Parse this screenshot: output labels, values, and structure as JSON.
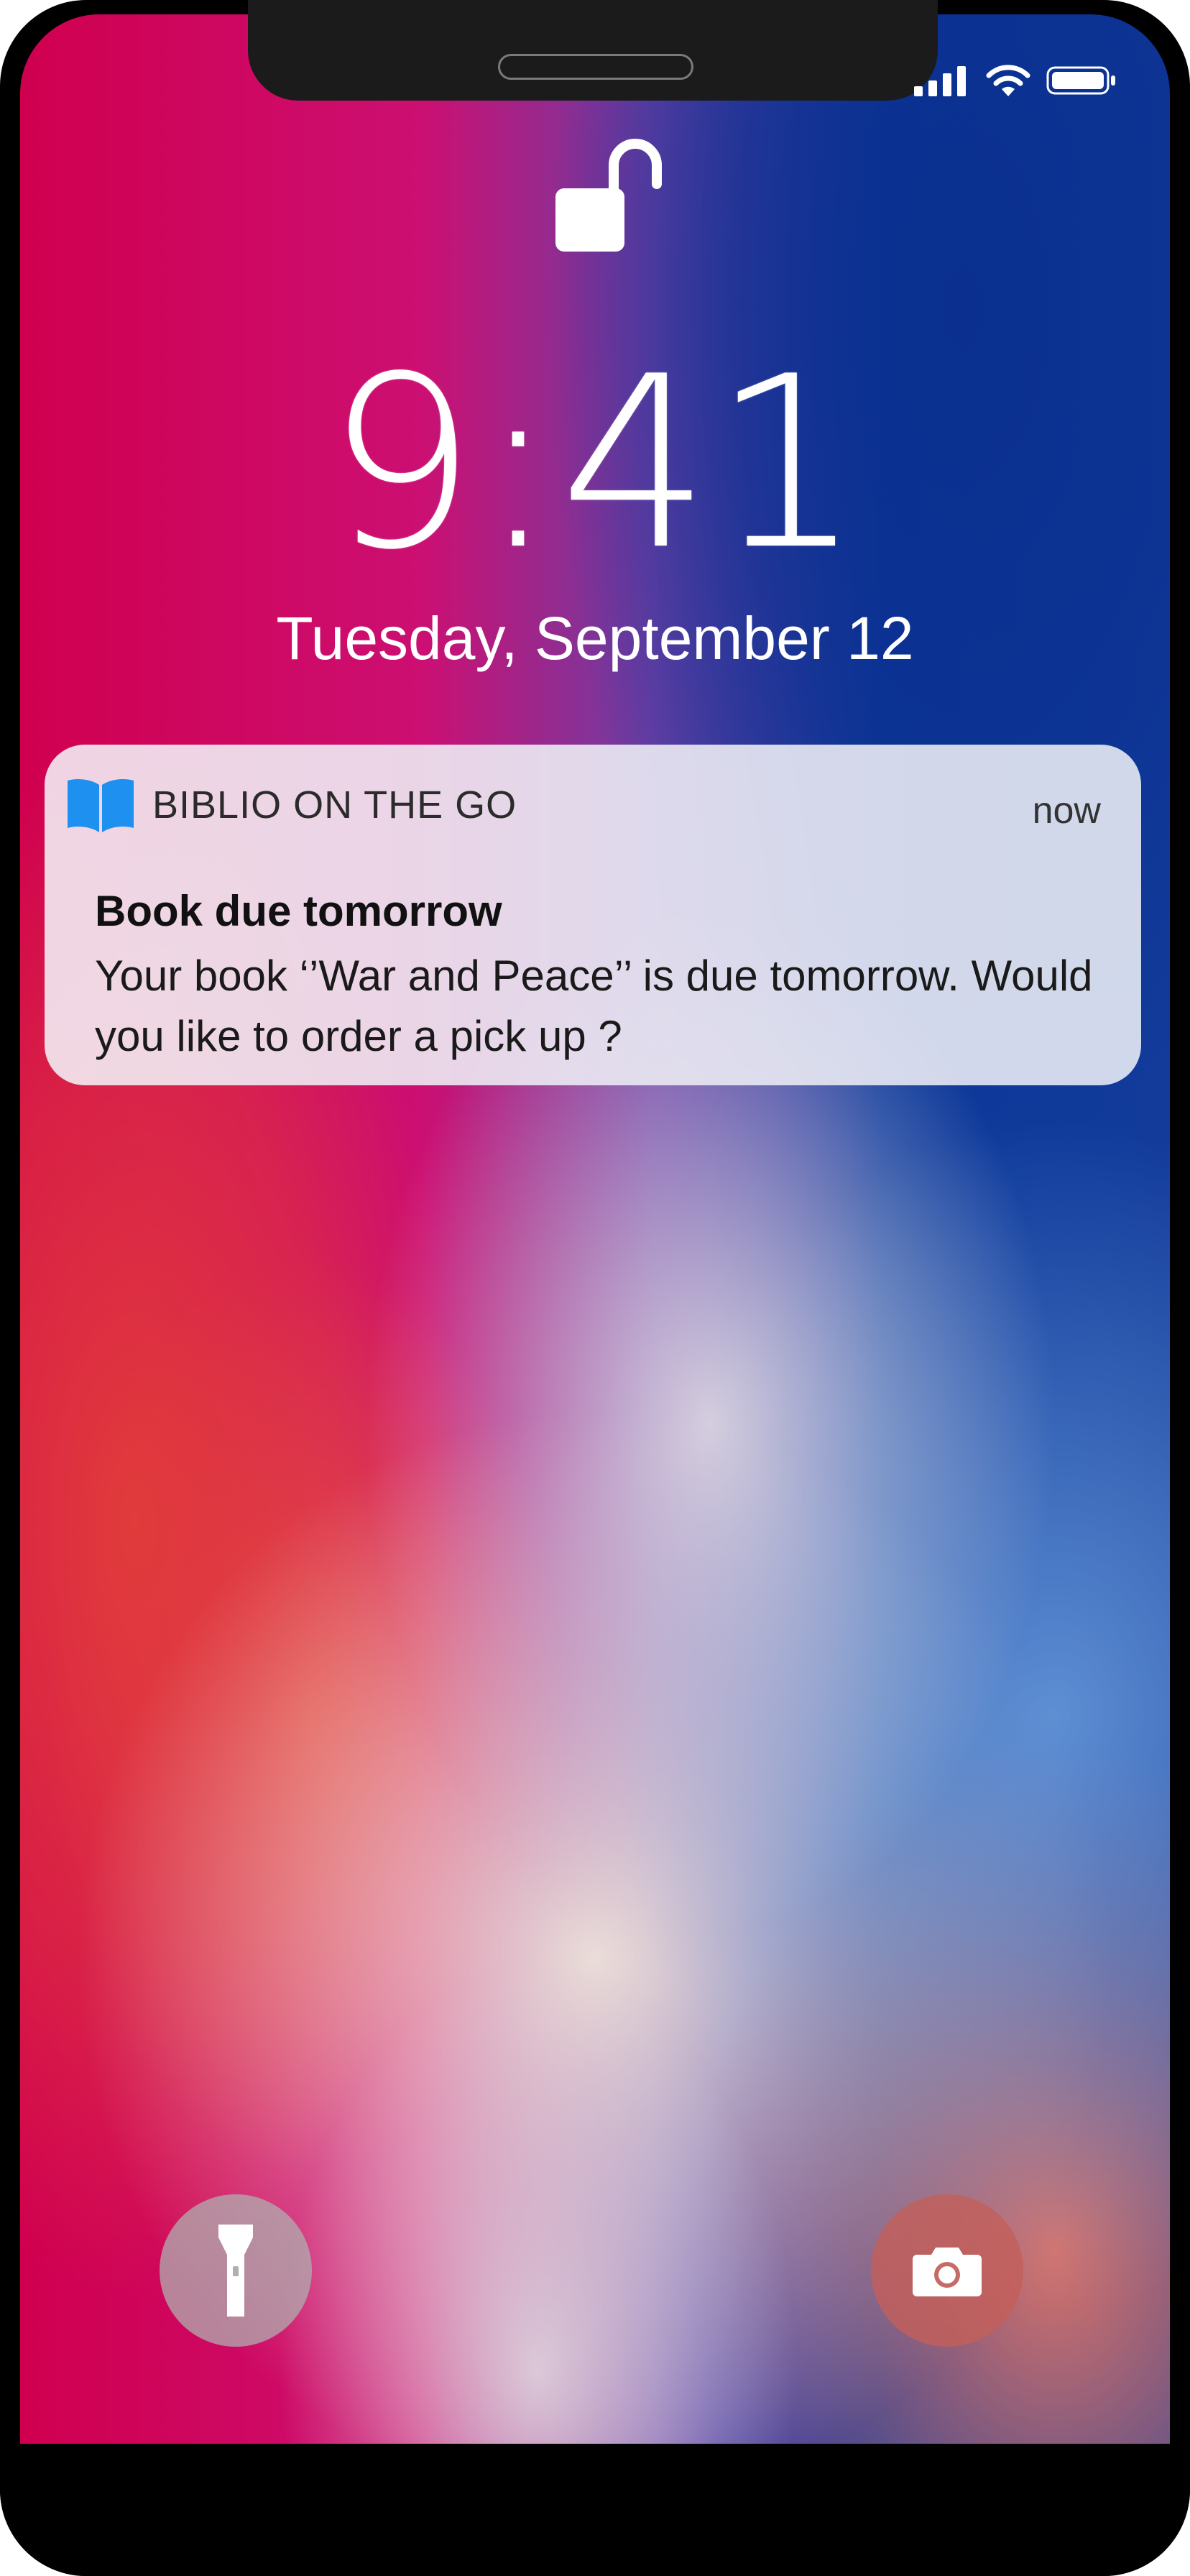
{
  "status_bar": {
    "signal_icon": "cellular-signal-icon",
    "wifi_icon": "wifi-icon",
    "battery_icon": "battery-icon"
  },
  "lock_screen": {
    "lock_icon": "unlocked-padlock-icon",
    "time": "9:41",
    "date": "Tuesday, September 12"
  },
  "notification": {
    "app_icon": "open-book-icon",
    "app_name": "BIBLIO ON THE GO",
    "timestamp": "now",
    "title": "Book due tomorrow",
    "body": "Your book ‘’War and Peace’’ is due tomorrow. Would you like to order a pick up ?"
  },
  "quick_actions": {
    "flashlight_icon": "flashlight-icon",
    "camera_icon": "camera-icon"
  },
  "colors": {
    "app_icon_blue": "#1e90ef",
    "text_white": "#ffffff",
    "wallpaper_magenta": "#cc0f72",
    "wallpaper_blue": "#0d3a9c"
  }
}
